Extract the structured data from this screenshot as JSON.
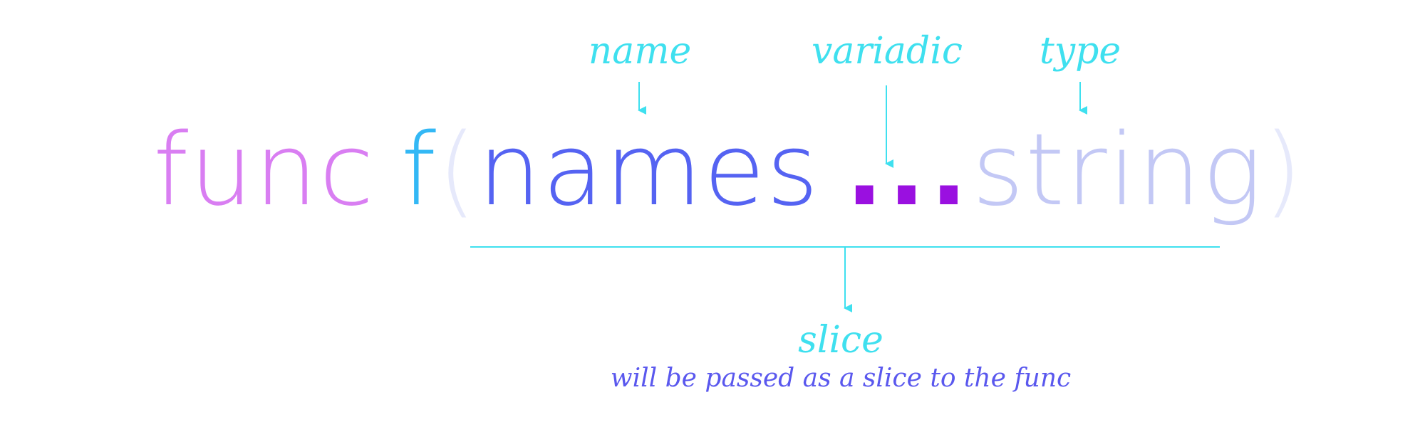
{
  "signature": {
    "keyword": "func",
    "function_name": "f",
    "open_paren": "(",
    "param_name": "names",
    "variadic": "...",
    "param_type": "string",
    "close_paren": ")"
  },
  "annotations": {
    "name": "name",
    "variadic": "variadic",
    "type": "type",
    "slice": "slice",
    "slice_description": "will be passed as a slice to the func"
  },
  "colors": {
    "keyword": "#d97ef2",
    "function_name": "#33b8f5",
    "paren": "#e6e9fb",
    "param_name": "#5563f2",
    "variadic": "#9a10e0",
    "param_type": "#c3c8f5",
    "annotation": "#3fe0ef",
    "description": "#5a58ee"
  }
}
